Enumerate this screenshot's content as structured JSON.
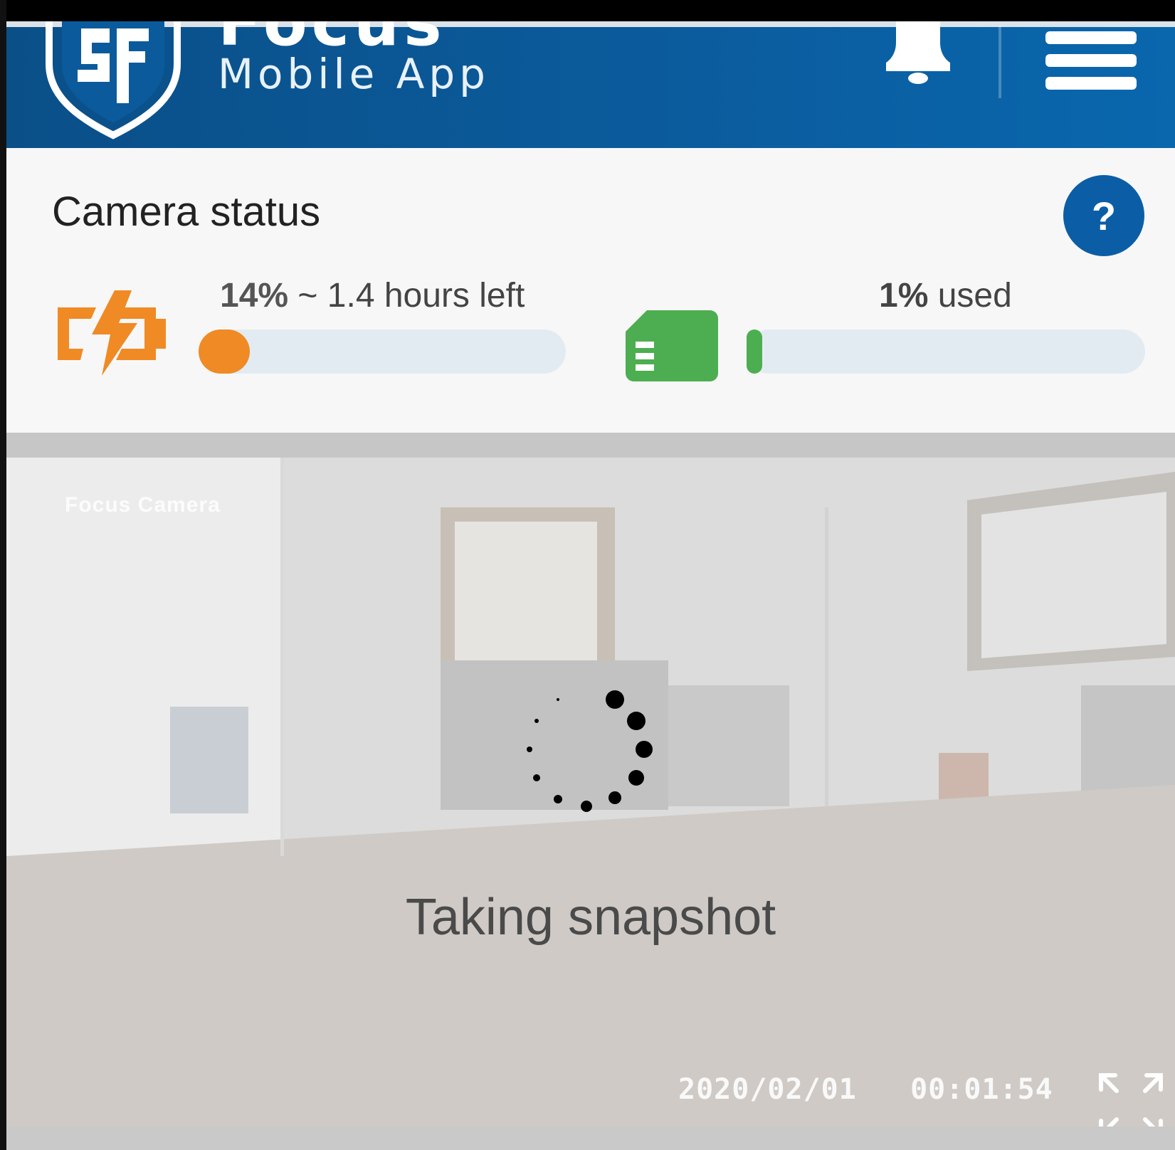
{
  "header": {
    "title": "Focus",
    "subtitle": "Mobile App",
    "icons": {
      "logo": "shield-logo",
      "notifications": "bell-icon",
      "menu": "hamburger-menu-icon"
    },
    "colors": {
      "background": "#0b5b9c"
    }
  },
  "status": {
    "title": "Camera status",
    "help_label": "?",
    "battery": {
      "percent": 14,
      "percent_label": "14%",
      "detail": "~ 1.4 hours left",
      "icon": "battery-charging-icon",
      "color": "#f08a24"
    },
    "storage": {
      "percent": 1,
      "percent_label": "1%",
      "detail": "used",
      "icon": "sd-card-icon",
      "color": "#4cae50"
    }
  },
  "camera": {
    "overlay_label": "Focus Camera",
    "loading_text": "Taking snapshot",
    "date": "2020/02/01",
    "time": "00:01:54",
    "icons": {
      "spinner": "loading-spinner-icon",
      "fullscreen": "expand-icon"
    }
  }
}
